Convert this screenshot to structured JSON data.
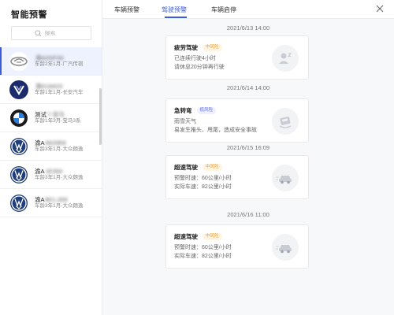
{
  "app_title": "智能预警",
  "search": {
    "placeholder": "搜索"
  },
  "vehicles": [
    {
      "plate": "渝A2GF33",
      "meta": "车龄2年1月-广汽传祺",
      "logo": "gac-logo-icon",
      "active": true
    },
    {
      "plate": "渝G16423",
      "meta": "车龄1年1月-长安汽车",
      "logo": "changan-logo-icon",
      "active": false
    },
    {
      "prefix": "测试",
      "plate": "7-宝马",
      "meta": "车龄1年3月-宝马3系",
      "logo": "bmw-logo-icon",
      "active": false
    },
    {
      "prefix": "渝A",
      "plate": "6620E8",
      "meta": "车龄3年1月-大众朗逸",
      "logo": "vw-logo-icon",
      "active": false
    },
    {
      "prefix": "渝A",
      "plate": "1E354",
      "meta": "车龄3年1月-大众朗逸",
      "logo": "vw-logo-icon",
      "active": false
    },
    {
      "prefix": "渝A",
      "plate": "BCL1E8",
      "meta": "车龄3年1月-大众朗逸",
      "logo": "vw-logo-icon",
      "active": false
    }
  ],
  "tabs": [
    {
      "label": "车辆预警",
      "active": false
    },
    {
      "label": "驾驶预警",
      "active": true
    },
    {
      "label": "车辆启停",
      "active": false
    }
  ],
  "alerts": [
    {
      "time": "2021/6/13  14:00",
      "title": "疲劳驾驶",
      "badge": "中风险",
      "level": "mid",
      "lines": [
        "已连续行驶4小时",
        "请休息20分钟再行驶"
      ],
      "icon": "fatigue-driver-icon"
    },
    {
      "time": "2021/6/14  14:00",
      "title": "急转弯",
      "badge": "低风险",
      "level": "low",
      "lines": [
        "雨雪天气",
        "易发生推头、甩尾，造成安全事故"
      ],
      "icon": "sharp-turn-icon"
    },
    {
      "time": "2021/6/15  16:09",
      "title": "超速驾驶",
      "badge": "中风险",
      "level": "mid",
      "lines": [
        "预警时速：60公里/小时",
        "实际车速：82公里/小时"
      ],
      "icon": "speeding-car-icon"
    },
    {
      "time": "2021/6/16  11:00",
      "title": "超速驾驶",
      "badge": "中风险",
      "level": "mid",
      "lines": [
        "预警时速：60公里/小时",
        "实际车速：82公里/小时"
      ],
      "icon": "speeding-car-icon"
    }
  ],
  "colors": {
    "accent": "#3b5bdb",
    "mid_risk": "#f59a23",
    "low_risk": "#5a6df0",
    "feed_bg": "#f7f8fa"
  }
}
